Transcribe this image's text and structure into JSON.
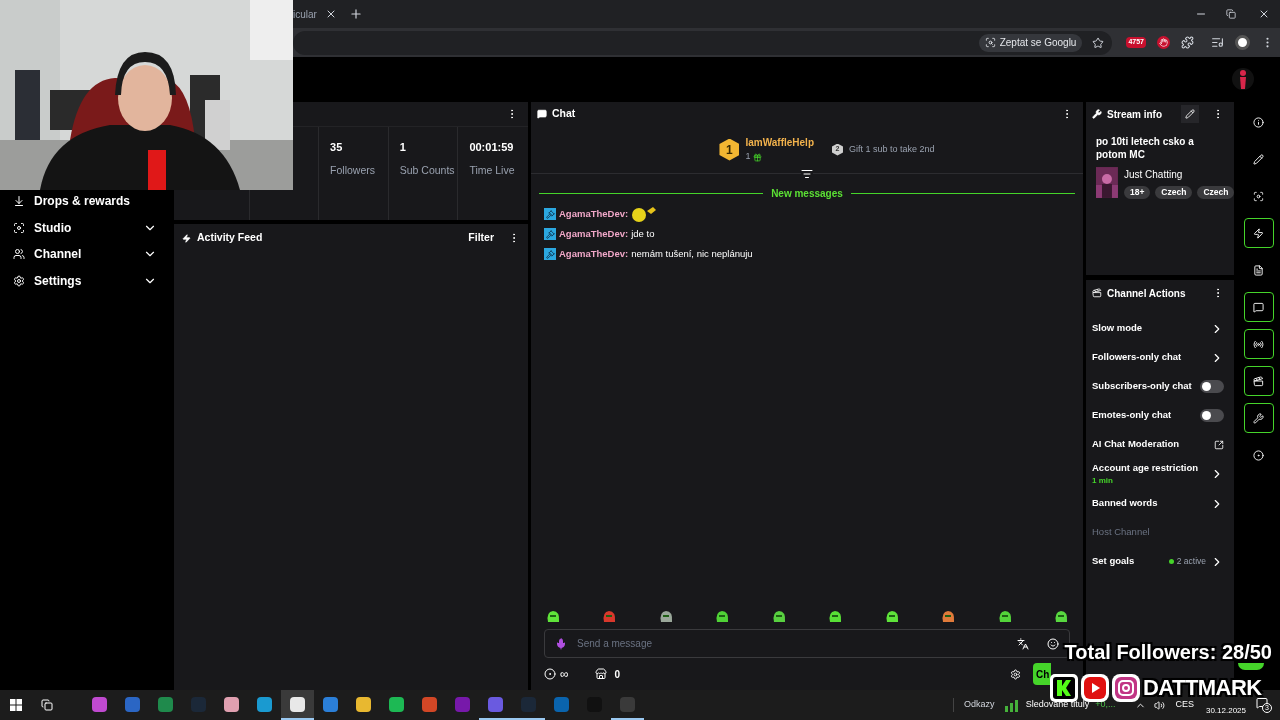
{
  "browser": {
    "tab_title": "icular",
    "ask_chip": "Zeptat se Googlu",
    "extension_badge": "4757"
  },
  "sidebar": {
    "items": [
      {
        "label": "Drops & rewards",
        "kind": "link"
      },
      {
        "label": "Studio",
        "kind": "group"
      },
      {
        "label": "Channel",
        "kind": "group"
      },
      {
        "label": "Settings",
        "kind": "group"
      }
    ]
  },
  "stats": {
    "items": [
      {
        "value": "35",
        "label": "Followers"
      },
      {
        "value": "1",
        "label": "Sub Counts"
      },
      {
        "value": "00:01:59",
        "label": "Time Live"
      }
    ]
  },
  "activity_feed": {
    "title": "Activity Feed",
    "filter": "Filter"
  },
  "chat": {
    "title": "Chat",
    "leader": {
      "rank": "1",
      "name": "IamWaffleHelp",
      "count": "1"
    },
    "next_rank": {
      "rank": "2",
      "text": "Gift 1 sub to take 2nd"
    },
    "divider": "New messages",
    "messages": [
      {
        "kind": "emote",
        "user": "AgamaTheDev:"
      },
      {
        "kind": "text",
        "user": "AgamaTheDev:",
        "text": "jde to"
      },
      {
        "kind": "text",
        "user": "AgamaTheDev:",
        "text": "nemám tušení, nic neplánuju"
      }
    ],
    "input": {
      "placeholder": "Send a message"
    },
    "points": "∞",
    "shop_count": "0",
    "send": "Ch"
  },
  "stream_info": {
    "title": "Stream info",
    "stream_title": "po 10ti letech csko a potom MC",
    "category": "Just Chatting",
    "tags": [
      "18+",
      "Czech",
      "Czech"
    ]
  },
  "channel_actions": {
    "title": "Channel Actions",
    "items": [
      {
        "label": "Slow mode",
        "kind": "chevron",
        "disabled": false
      },
      {
        "label": "Followers-only chat",
        "kind": "chevron",
        "disabled": false
      },
      {
        "label": "Subscribers-only chat",
        "kind": "toggle",
        "on": false,
        "disabled": false
      },
      {
        "label": "Emotes-only chat",
        "kind": "toggle",
        "on": false,
        "disabled": false
      },
      {
        "label": "AI Chat Moderation",
        "kind": "external",
        "disabled": false
      },
      {
        "label": "Account age restriction",
        "kind": "chevron",
        "detail": "1 min",
        "disabled": false
      },
      {
        "label": "Banned words",
        "kind": "chevron",
        "disabled": false
      },
      {
        "label": "Host Channel",
        "kind": "plain",
        "disabled": true
      },
      {
        "label": "Set goals",
        "kind": "chevron",
        "status": "2 active",
        "disabled": false
      }
    ]
  },
  "quick_actions": [
    {
      "active": false
    },
    {
      "active": false
    },
    {
      "active": false
    },
    {
      "active": true
    },
    {
      "active": false
    },
    {
      "active": true
    },
    {
      "active": true
    },
    {
      "active": true
    },
    {
      "active": true
    },
    {
      "active": false
    }
  ],
  "overlay": {
    "goal": "Total Followers: 28/50",
    "brand": "DATTMARK"
  },
  "taskbar": {
    "apps": [
      {
        "selected": false,
        "running": false
      },
      {
        "selected": false,
        "running": false
      },
      {
        "selected": false,
        "running": false
      },
      {
        "selected": false,
        "running": false
      },
      {
        "selected": false,
        "running": false
      },
      {
        "selected": false,
        "running": false
      },
      {
        "selected": true,
        "running": true
      },
      {
        "selected": false,
        "running": false
      },
      {
        "selected": false,
        "running": false
      },
      {
        "selected": false,
        "running": false
      },
      {
        "selected": false,
        "running": false
      },
      {
        "selected": false,
        "running": false
      },
      {
        "selected": false,
        "running": true
      },
      {
        "selected": false,
        "running": true
      },
      {
        "selected": false,
        "running": false
      },
      {
        "selected": false,
        "running": false
      },
      {
        "selected": false,
        "running": true
      }
    ],
    "links": "Odkazy",
    "widget_title": "Sledované tituly",
    "widget_change": "+0,...",
    "language": "CES",
    "date": "30.12.2025",
    "notifications": "3"
  }
}
